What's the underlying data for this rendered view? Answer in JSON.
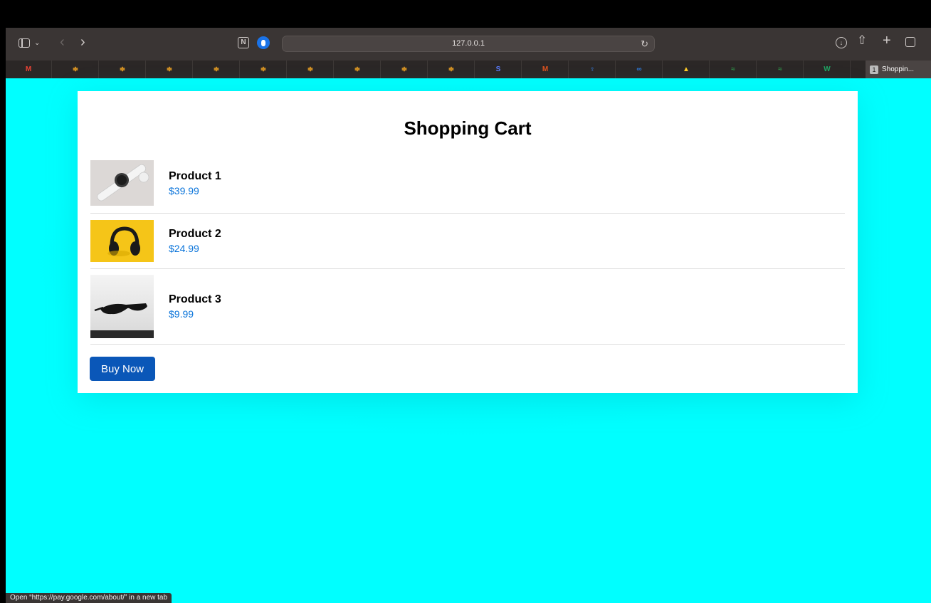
{
  "browser": {
    "url": "127.0.0.1",
    "active_tab_index": "1",
    "active_tab_label": "Shoppin...",
    "bookmarks": [
      {
        "icon": "gmail-icon",
        "glyph": "M",
        "color": "#ea4335"
      },
      {
        "icon": "extension-icon",
        "glyph": "≑",
        "color": "#f5a623"
      },
      {
        "icon": "extension-icon",
        "glyph": "≑",
        "color": "#f5a623"
      },
      {
        "icon": "extension-icon",
        "glyph": "≑",
        "color": "#f5a623"
      },
      {
        "icon": "extension-icon",
        "glyph": "≑",
        "color": "#f5a623"
      },
      {
        "icon": "extension-icon",
        "glyph": "≑",
        "color": "#f5a623"
      },
      {
        "icon": "extension-icon",
        "glyph": "≑",
        "color": "#f5a623"
      },
      {
        "icon": "extension-icon",
        "glyph": "≑",
        "color": "#f5a623"
      },
      {
        "icon": "extension-icon",
        "glyph": "≑",
        "color": "#f5a623"
      },
      {
        "icon": "extension-icon",
        "glyph": "≑",
        "color": "#f5a623"
      },
      {
        "icon": "app-icon",
        "glyph": "S",
        "color": "#5a7cff"
      },
      {
        "icon": "app-icon",
        "glyph": "M",
        "color": "#e0531f"
      },
      {
        "icon": "bulb-icon",
        "glyph": "♀",
        "color": "#3a8bff"
      },
      {
        "icon": "app-icon",
        "glyph": "∞",
        "color": "#2f7de1"
      },
      {
        "icon": "firebase-icon",
        "glyph": "▲",
        "color": "#ffca28"
      },
      {
        "icon": "gfg-icon",
        "glyph": "≈",
        "color": "#2f8d46"
      },
      {
        "icon": "gfg-icon",
        "glyph": "≈",
        "color": "#2f8d46"
      },
      {
        "icon": "app-icon",
        "glyph": "W",
        "color": "#1fa463"
      }
    ]
  },
  "cart": {
    "title": "Shopping Cart",
    "items": [
      {
        "name": "Product 1",
        "price": "$39.99"
      },
      {
        "name": "Product 2",
        "price": "$24.99"
      },
      {
        "name": "Product 3",
        "price": "$9.99"
      }
    ],
    "buy_label": "Buy Now"
  },
  "colors": {
    "page_bg": "#00ffff",
    "price": "#0a74da",
    "button": "#0a57b8"
  },
  "status_bar": "Open “https://pay.google.com/about/” in a new tab"
}
